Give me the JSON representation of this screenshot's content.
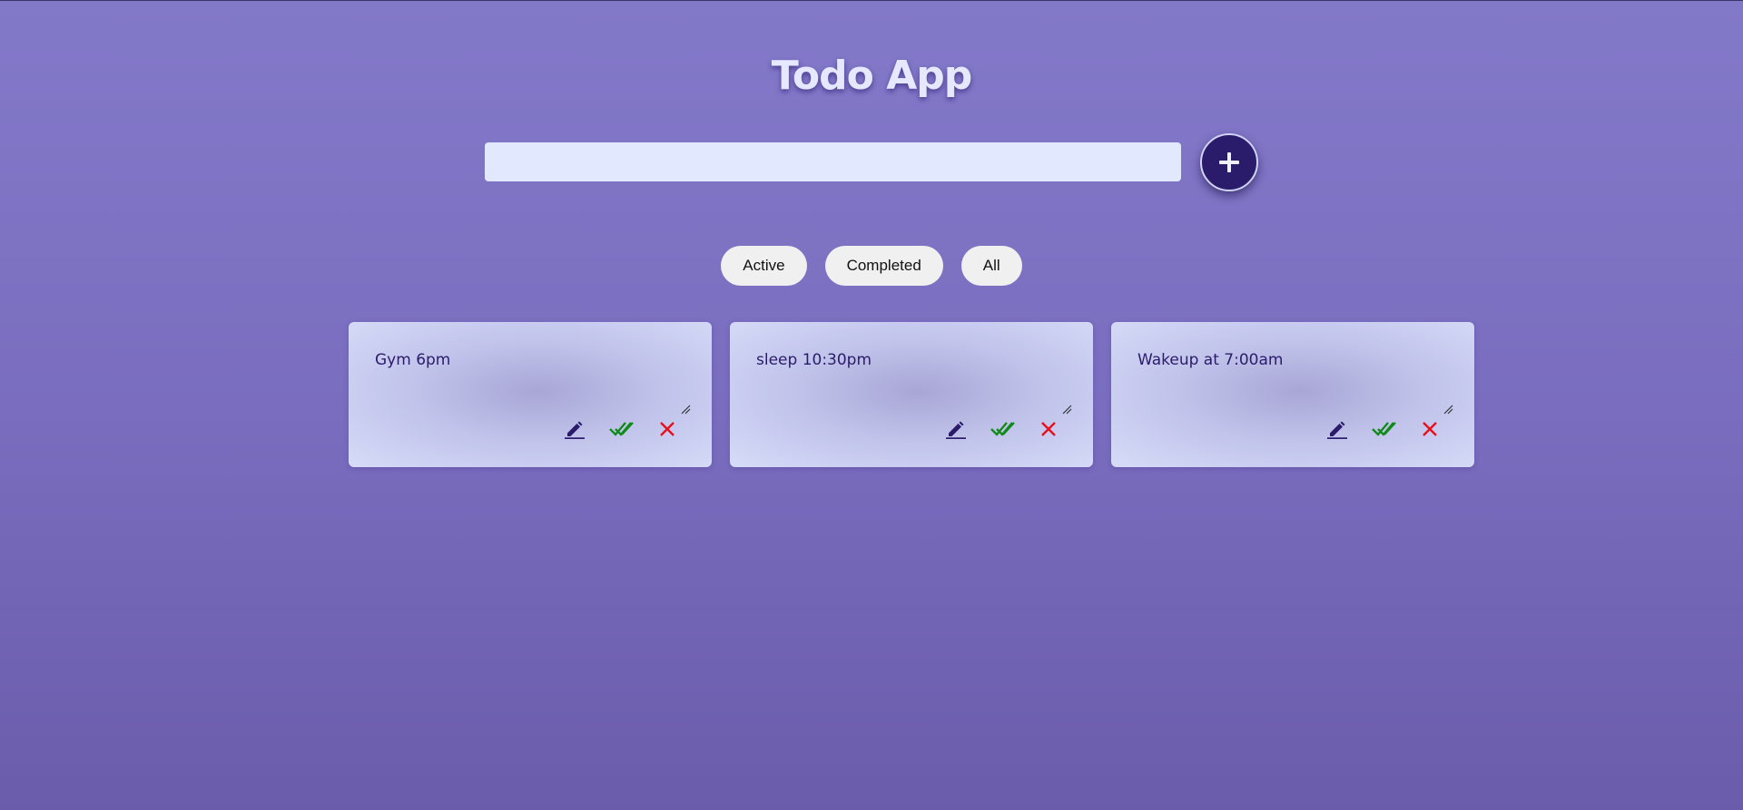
{
  "header": {
    "title": "Todo App"
  },
  "new_todo": {
    "value": "",
    "placeholder": "",
    "add_icon": "plus-icon"
  },
  "filters": [
    {
      "label": "Active"
    },
    {
      "label": "Completed"
    },
    {
      "label": "All"
    }
  ],
  "todos": [
    {
      "text": "Gym 6pm",
      "actions": [
        "pencil-icon",
        "double-check-icon",
        "close-icon"
      ]
    },
    {
      "text": "sleep 10:30pm",
      "actions": [
        "pencil-icon",
        "double-check-icon",
        "close-icon"
      ]
    },
    {
      "text": "Wakeup at 7:00am",
      "actions": [
        "pencil-icon",
        "double-check-icon",
        "close-icon"
      ]
    }
  ],
  "colors": {
    "background_top": "#8379c9",
    "background_bottom": "#6b5cab",
    "primary": "#2b1c6b",
    "input_bg": "#e2e8fd",
    "complete": "#118a1a",
    "delete": "#e8101a"
  }
}
